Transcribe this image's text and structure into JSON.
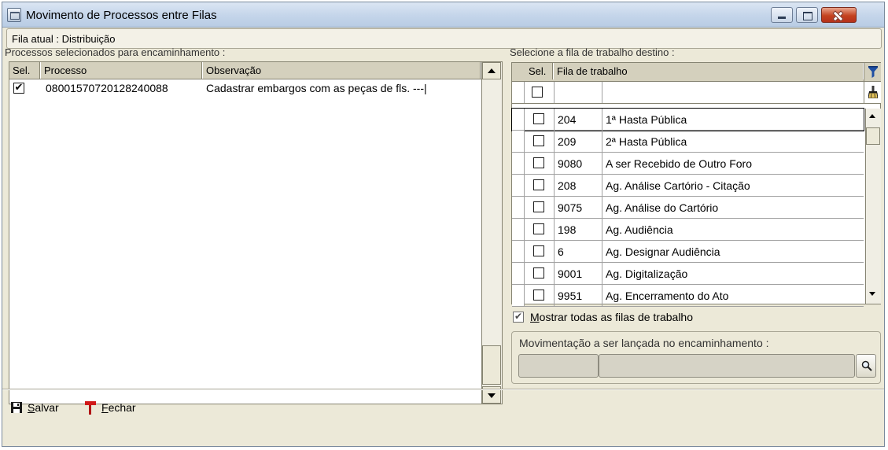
{
  "window": {
    "title": "Movimento de Processos entre Filas"
  },
  "fila_atual": "Fila atual : Distribuição",
  "left_panel": {
    "caption": "Processos selecionados para encaminhamento :",
    "columns": [
      "Sel.",
      "Processo",
      "Observação"
    ],
    "rows": [
      {
        "selected": true,
        "processo": "08001570720128240088",
        "observacao": "Cadastrar embargos com as peças de fls. ---|"
      }
    ]
  },
  "right_panel": {
    "caption": "Selecione a fila de trabalho destino :",
    "columns": [
      "Sel.",
      "Fila de trabalho"
    ],
    "rows": [
      {
        "code": "204",
        "name": "1ª Hasta Pública",
        "selected": false
      },
      {
        "code": "209",
        "name": "2ª Hasta Pública",
        "selected": false
      },
      {
        "code": "9080",
        "name": "A ser Recebido de Outro Foro",
        "selected": false
      },
      {
        "code": "208",
        "name": "Ag. Análise Cartório - Citação",
        "selected": false
      },
      {
        "code": "9075",
        "name": "Ag. Análise do Cartório",
        "selected": false
      },
      {
        "code": "198",
        "name": "Ag. Audiência",
        "selected": false
      },
      {
        "code": "6",
        "name": "Ag. Designar Audiência",
        "selected": false
      },
      {
        "code": "9001",
        "name": "Ag. Digitalização",
        "selected": false
      },
      {
        "code": "9951",
        "name": "Ag. Encerramento do Ato",
        "selected": false
      }
    ],
    "show_all": {
      "checked": true,
      "accel": "M",
      "label_rest": "ostrar todas as filas de trabalho"
    },
    "movimentacao_label": "Movimentação a ser lançada no encaminhamento :"
  },
  "toolbar": {
    "salvar": {
      "accel": "S",
      "rest": "alvar"
    },
    "fechar": {
      "accel": "F",
      "rest": "echar"
    }
  },
  "icons": {
    "app": "window-icon",
    "filter": "funnel-filter-icon",
    "clear_filter": "broom-icon",
    "search": "magnifier-icon",
    "save": "floppy-disk-icon",
    "close": "red-flag-icon"
  },
  "colors": {
    "title_bar": "#c4d5ea",
    "window_bg": "#ece9d8",
    "close_button": "#c4421f",
    "filter_icon": "#1f4fa3",
    "fechar_icon": "#d01818"
  }
}
